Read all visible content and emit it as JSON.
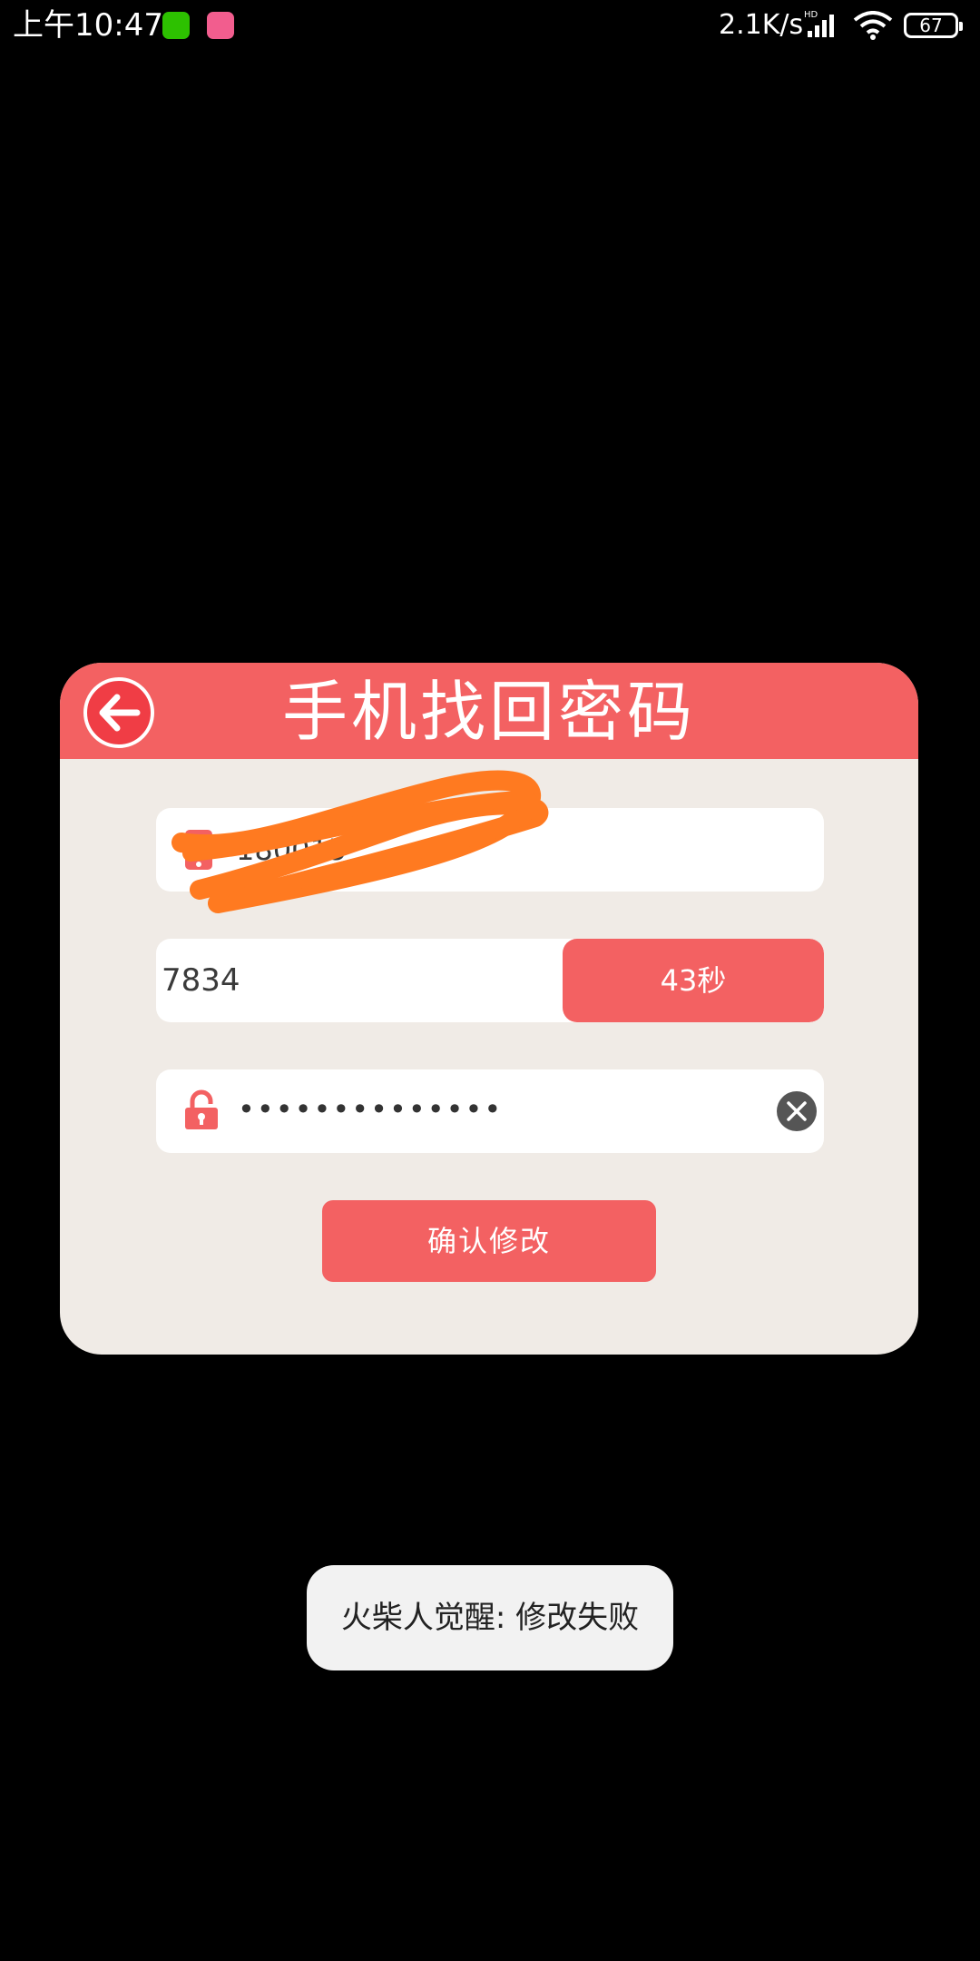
{
  "status_bar": {
    "time": "上午10:47",
    "apps": [
      "wechat-icon",
      "bilibili-icon"
    ],
    "network_speed": "2.1K/s",
    "network_type": "HD",
    "battery": "67"
  },
  "dialog": {
    "title": "手机找回密码",
    "phone": {
      "value": "180015"
    },
    "code": {
      "value": "7834",
      "countdown_label": "43秒"
    },
    "password": {
      "masked_value": "••••••••••••••"
    },
    "confirm_label": "确认修改"
  },
  "toast": {
    "message": "火柴人觉醒: 修改失败"
  },
  "colors": {
    "accent": "#f36162",
    "card_background": "#f0ebe6",
    "redaction": "#ff7a20"
  }
}
